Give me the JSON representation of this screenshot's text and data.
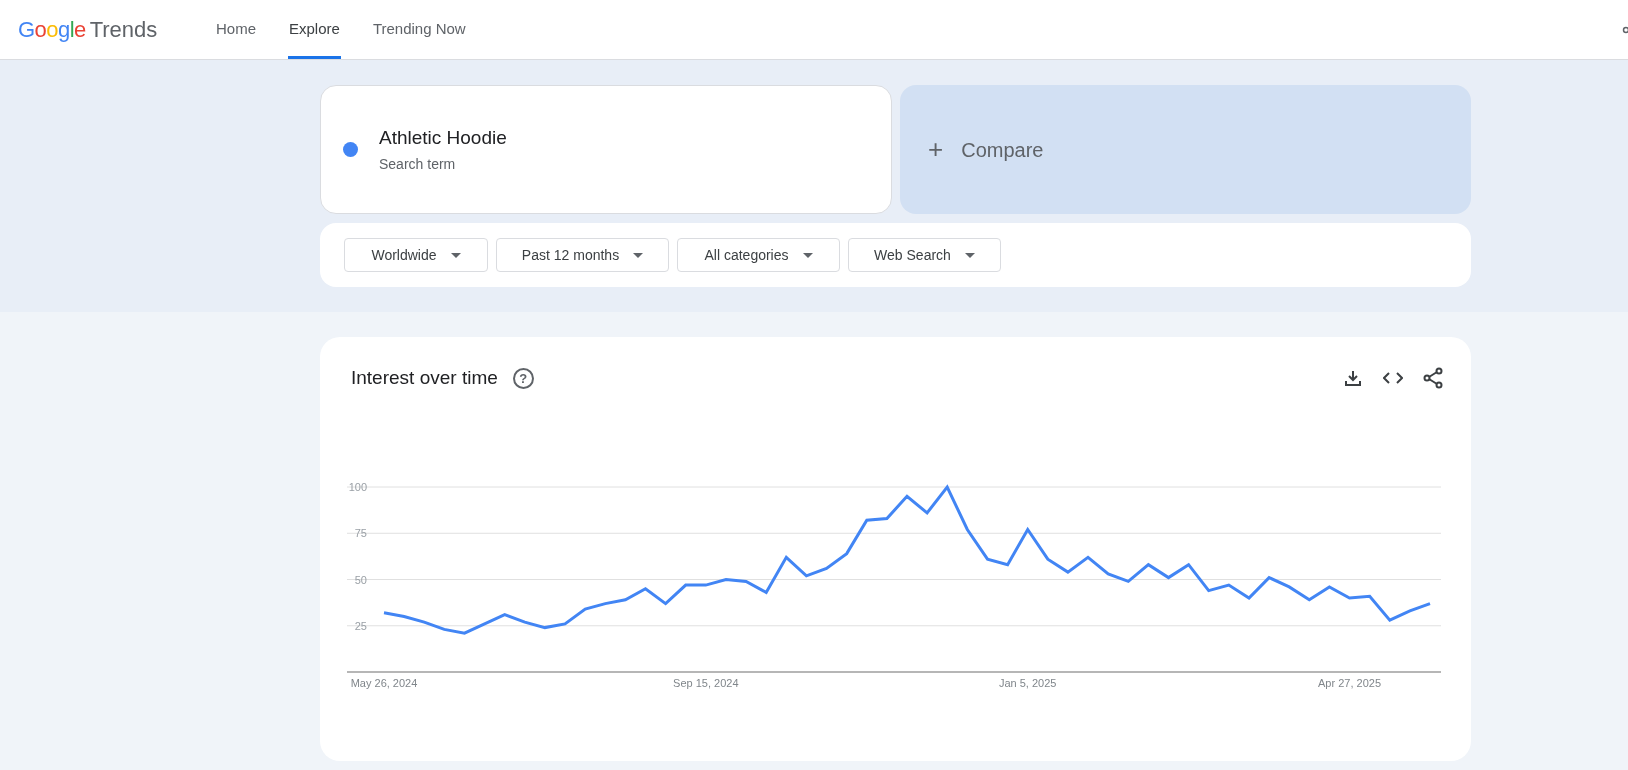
{
  "header": {
    "logo_google": "Google",
    "logo_product": "Trends",
    "nav": [
      {
        "label": "Home",
        "selected": false
      },
      {
        "label": "Explore",
        "selected": true
      },
      {
        "label": "Trending Now",
        "selected": false
      }
    ]
  },
  "search_term": {
    "term": "Athletic Hoodie",
    "subtitle": "Search term",
    "color": "#4285f4"
  },
  "compare": {
    "icon": "+",
    "label": "Compare"
  },
  "filters": [
    "Worldwide",
    "Past 12 months",
    "All categories",
    "Web Search"
  ],
  "interest_over_time": {
    "title": "Interest over time",
    "help": "?",
    "chart_data": {
      "type": "line",
      "categories": [
        "May 26, 2024",
        null,
        null,
        null,
        null,
        null,
        null,
        null,
        null,
        null,
        null,
        null,
        null,
        null,
        null,
        null,
        "Sep 15, 2024",
        null,
        null,
        null,
        null,
        null,
        null,
        null,
        null,
        null,
        null,
        null,
        null,
        null,
        null,
        null,
        "Jan 5, 2025",
        null,
        null,
        null,
        null,
        null,
        null,
        null,
        null,
        null,
        null,
        null,
        null,
        null,
        null,
        null,
        "Apr 27, 2025",
        null,
        null,
        null,
        null
      ],
      "series": [
        {
          "color": "#4285f4",
          "values": [
            32,
            30,
            27,
            23,
            21,
            26,
            31,
            27,
            24,
            26,
            34,
            37,
            39,
            45,
            37,
            47,
            47,
            50,
            49,
            43,
            62,
            52,
            56,
            64,
            82,
            83,
            95,
            86,
            100,
            77,
            61,
            58,
            77,
            61,
            54,
            62,
            53,
            49,
            58,
            51,
            58,
            44,
            47,
            40,
            51,
            46,
            39,
            46,
            40,
            41,
            28,
            33,
            37
          ]
        }
      ],
      "ylim": [
        0,
        100
      ],
      "yticks": [
        25,
        50,
        75,
        100
      ],
      "grid": true
    }
  }
}
